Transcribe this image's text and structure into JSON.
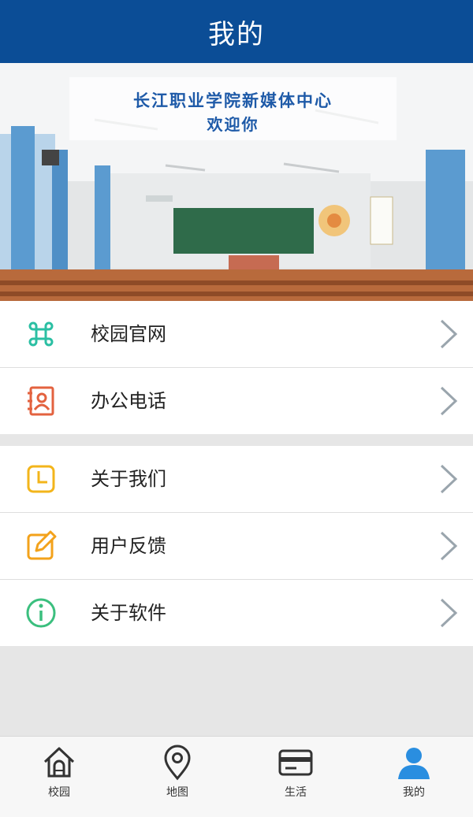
{
  "header": {
    "title": "我的"
  },
  "banner": {
    "line1": "长江职业学院新媒体中心",
    "line2": "欢迎你"
  },
  "colors": {
    "header_bg": "#0b4d96",
    "accent_active": "#2a8ee0",
    "chevron": "#9aa5ad"
  },
  "menu_group_1": [
    {
      "label": "校园官网",
      "icon": "command-icon",
      "color": "#2bbfa3"
    },
    {
      "label": "办公电话",
      "icon": "contact-book-icon",
      "color": "#e3623f"
    }
  ],
  "menu_group_2": [
    {
      "label": "关于我们",
      "icon": "clock-icon",
      "color": "#f3b51b"
    },
    {
      "label": "用户反馈",
      "icon": "edit-icon",
      "color": "#f3a21b"
    },
    {
      "label": "关于软件",
      "icon": "info-icon",
      "color": "#3bbf7e"
    }
  ],
  "tabbar": {
    "tabs": [
      {
        "label": "校园",
        "icon": "house-icon"
      },
      {
        "label": "地图",
        "icon": "map-pin-icon"
      },
      {
        "label": "生活",
        "icon": "card-icon"
      },
      {
        "label": "我的",
        "icon": "user-icon",
        "active": true
      }
    ]
  }
}
